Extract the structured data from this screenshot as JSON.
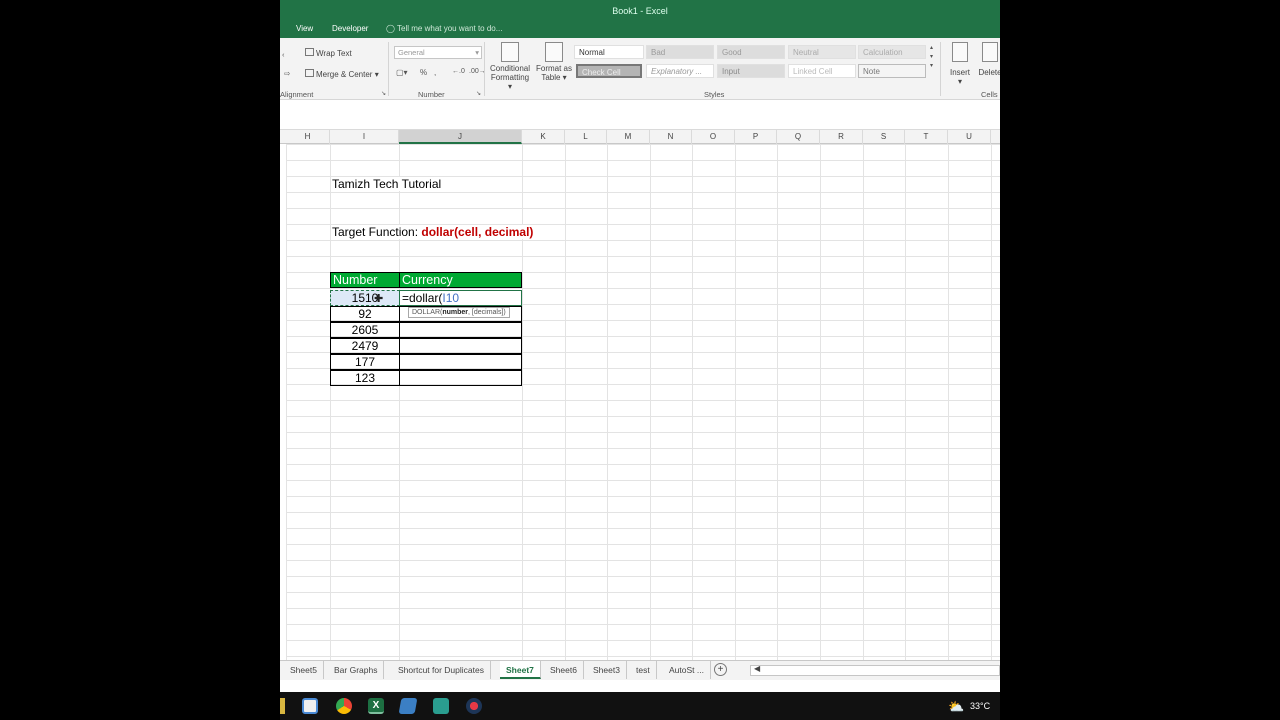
{
  "window": {
    "title": "Book1 - Excel"
  },
  "ribbon_tabs": [
    "View",
    "Developer"
  ],
  "tell_me": "Tell me what you want to do...",
  "ribbon": {
    "wrap_text": "Wrap Text",
    "merge_center": "Merge & Center",
    "alignment_label": "Alignment",
    "number_format": "General",
    "number_label": "Number",
    "percent": "%",
    "comma": ",",
    "conditional_formatting": [
      "Conditional",
      "Formatting"
    ],
    "format_as_table": [
      "Format as",
      "Table"
    ],
    "styles": [
      "Normal",
      "Bad",
      "Good",
      "Neutral",
      "Calculation",
      "Check Cell",
      "Explanatory ...",
      "Input",
      "Linked Cell",
      "Note"
    ],
    "styles_label": "Styles",
    "insert": "Insert",
    "delete": "Delete",
    "cells_label": "Cells"
  },
  "columns": [
    "H",
    "I",
    "J",
    "K",
    "L",
    "M",
    "N",
    "O",
    "P",
    "Q",
    "R",
    "S",
    "T",
    "U"
  ],
  "sheet": {
    "title": "Tamizh Tech Tutorial",
    "target_prefix": "Target Function: ",
    "target_function": "dollar(cell, decimal)",
    "header_number": "Number",
    "header_currency": "Currency",
    "numbers": [
      "1510",
      "92",
      "2605",
      "2479",
      "177",
      "123"
    ],
    "editing_formula_text": "=dollar(",
    "editing_formula_ref": "I10",
    "tooltip_fn": "DOLLAR(",
    "tooltip_arg1": "number",
    "tooltip_rest": ", [decimals])"
  },
  "sheet_tabs": [
    "Sheet5",
    "Bar Graphs",
    "Shortcut for Duplicates",
    "Sheet7",
    "Sheet6",
    "Sheet3",
    "test",
    "AutoSt ..."
  ],
  "active_sheet": "Sheet7",
  "taskbar": {
    "temperature": "33°C"
  },
  "colors": {
    "excel_green": "#217346",
    "header_green": "#00a933",
    "target_red": "#c00000"
  }
}
